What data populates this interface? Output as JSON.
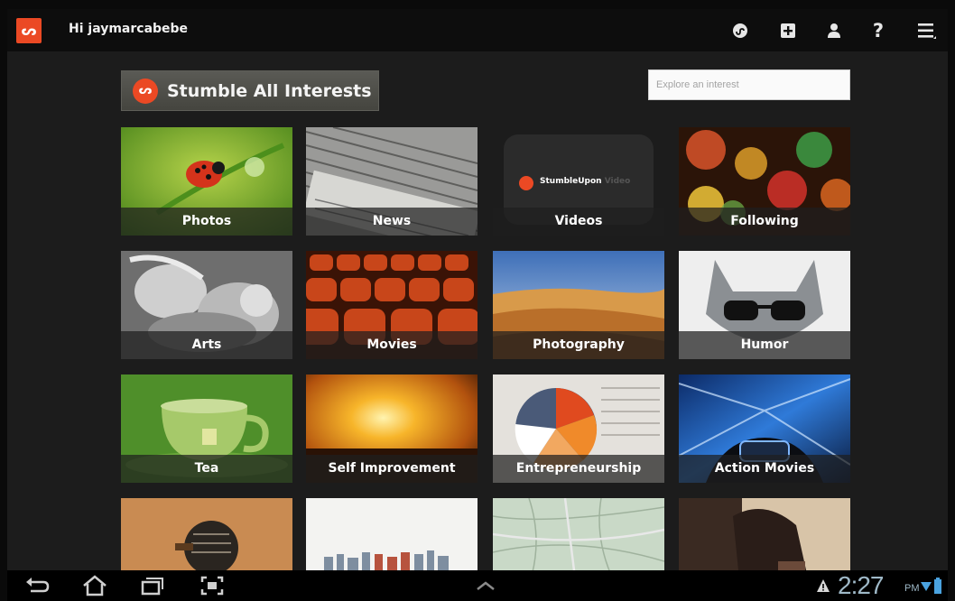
{
  "header": {
    "greeting": "Hi jaymarcabebe",
    "logo_glyph": "ᔕ",
    "icons": [
      "stumble-icon",
      "add-icon",
      "profile-icon",
      "help-icon",
      "menu-icon"
    ],
    "help_label": "?"
  },
  "stumble_all": {
    "label": "Stumble All Interests",
    "glyph": "ᔕ"
  },
  "search": {
    "placeholder": "Explore an interest",
    "value": ""
  },
  "videos_tile_brand": "StumbleUpon",
  "videos_tile_brand_suffix": "Video",
  "tiles": [
    {
      "label": "Photos"
    },
    {
      "label": "News"
    },
    {
      "label": "Videos"
    },
    {
      "label": "Following"
    },
    {
      "label": "Arts"
    },
    {
      "label": "Movies"
    },
    {
      "label": "Photography"
    },
    {
      "label": "Humor"
    },
    {
      "label": "Tea"
    },
    {
      "label": "Self Improvement"
    },
    {
      "label": "Entrepreneurship"
    },
    {
      "label": "Action Movies"
    },
    {
      "label": ""
    },
    {
      "label": ""
    },
    {
      "label": ""
    },
    {
      "label": ""
    }
  ],
  "status": {
    "time": "2:27",
    "ampm": "PM"
  },
  "colors": {
    "brand": "#eb4924",
    "background": "#1c1c1c",
    "clock": "#9fb9c8"
  }
}
